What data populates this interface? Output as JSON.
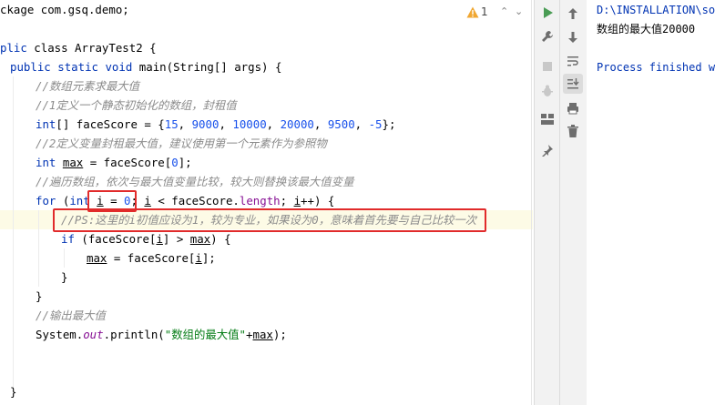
{
  "editor": {
    "lines": {
      "l0": "ckage com.gsq.demo;",
      "l1a": "plic",
      "l1b": " class ArrayTest2 {",
      "l2a": "public",
      "l2b": "static",
      "l2c": "void",
      "l2d": "main(String[] args) {",
      "l3": "//数组元素求最大值",
      "l4": "//1定义一个静态初始化的数组，封租值",
      "l5a": "int",
      "l5b": "[] faceScore = {",
      "l5n1": "15",
      "l5n2": "9000",
      "l5n3": "10000",
      "l5n4": "20000",
      "l5n5": "9500",
      "l5n6": "-5",
      "l5c": ", ",
      "l5d": "};",
      "l6": "//2定义变量封租最大值，建议使用第一个元素作为参照物",
      "l7a": "int",
      "l7b": "max",
      "l7c": " = faceScore[",
      "l7n": "0",
      "l7d": "];",
      "l8": "//遍历数组，依次与最大值变量比较，较大则替换该最大值变量",
      "l9a": "for",
      "l9b": " (",
      "l9c": "int",
      "l9d": "i",
      "l9e": " = ",
      "l9n": "0",
      "l9f": "; ",
      "l9g": "i",
      "l9h": " < faceScore.",
      "l9i": "length",
      "l9j": "; ",
      "l9k": "i",
      "l9l": "++) {",
      "l10": "//PS:这里的i初值应设为1，较为专业，如果设为0，意味着首先要与自己比较一次",
      "l11a": "if",
      "l11b": " (faceScore[",
      "l11c": "i",
      "l11d": "] > ",
      "l11e": "max",
      "l11f": ") {",
      "l12a": "max",
      "l12b": " = faceScore[",
      "l12c": "i",
      "l12d": "];",
      "l13": "}",
      "l14": "}",
      "l15": "//输出最大值",
      "l16a": "System.",
      "l16b": "out",
      "l16c": ".println(",
      "l16d": "\"数组的最大值\"",
      "l16e": "+",
      "l16f": "max",
      "l16g": ");",
      "l17": "}"
    },
    "warnings": {
      "icon": "warning-icon",
      "count": "1"
    }
  },
  "console": {
    "path": "D:\\INSTALLATION\\sof",
    "output": "数组的最大值20000",
    "finished": "Process finished wi"
  },
  "colors": {
    "keyword": "#0033b3",
    "number": "#1750eb",
    "comment": "#8c8c8c",
    "string": "#067d17",
    "field": "#871094",
    "highlight_box": "#e12b2b",
    "run_icon": "#499c54"
  },
  "toolbar_left": [
    "run-icon",
    "wrench-icon",
    "stop-icon",
    "debug-icon",
    "layout-icon",
    "pin-icon"
  ],
  "toolbar_right": [
    "up-arrow-icon",
    "down-arrow-icon",
    "soft-wrap-icon",
    "scroll-to-end-icon",
    "print-icon",
    "trash-icon"
  ]
}
